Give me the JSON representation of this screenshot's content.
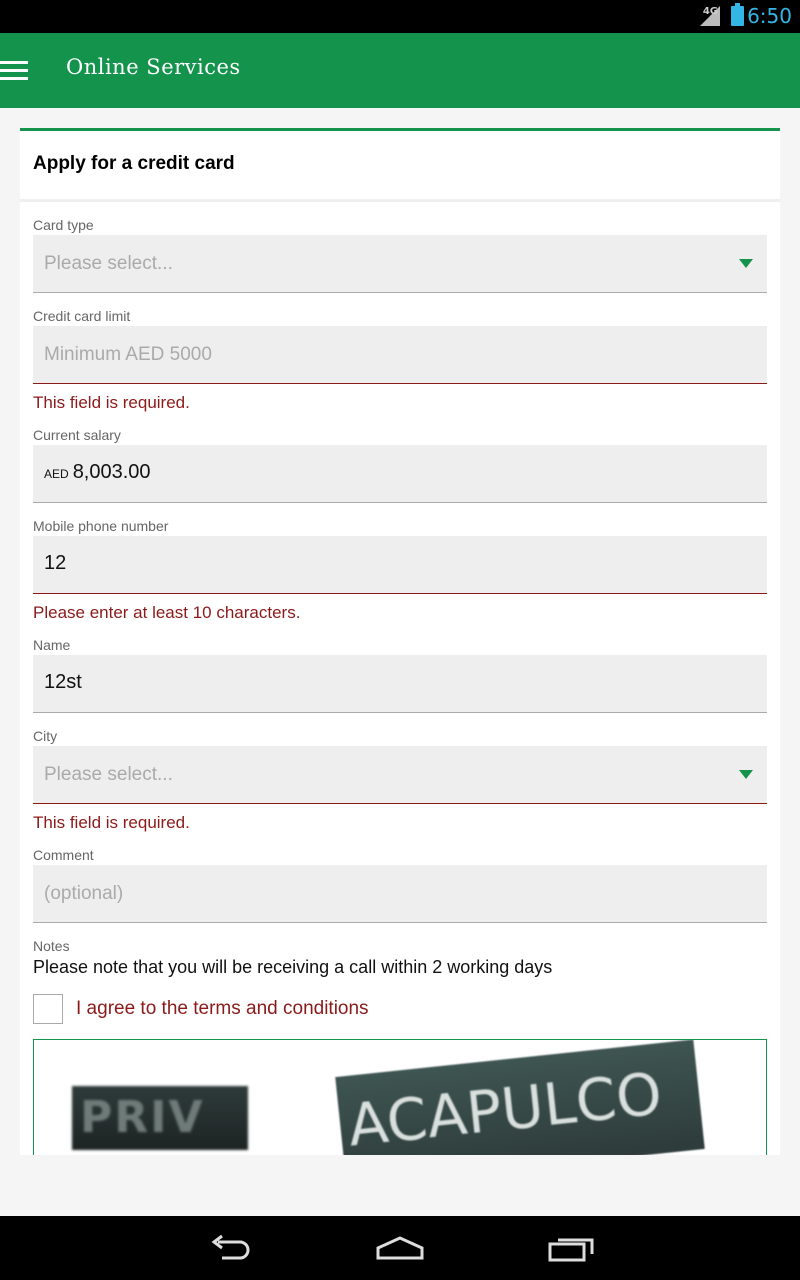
{
  "status_bar": {
    "network": "4G",
    "time": "6:50"
  },
  "app_bar": {
    "title": "Online Services",
    "menu_icon": "hamburger-menu-icon"
  },
  "form": {
    "title": "Apply for a credit card",
    "card_type": {
      "label": "Card type",
      "placeholder": "Please select..."
    },
    "credit_limit": {
      "label": "Credit card limit",
      "placeholder": "Minimum AED 5000",
      "error": "This field is required."
    },
    "current_salary": {
      "label": "Current salary",
      "currency": "AED",
      "value": "8,003.00"
    },
    "mobile_phone": {
      "label": "Mobile phone number",
      "value": "12",
      "error": "Please enter at least 10 characters."
    },
    "name": {
      "label": "Name",
      "value": "12st"
    },
    "city": {
      "label": "City",
      "placeholder": "Please select...",
      "error": "This field is required."
    },
    "comment": {
      "label": "Comment",
      "placeholder": "(optional)"
    },
    "notes": {
      "label": "Notes",
      "text": "Please note that you will be receiving a call within 2 working days"
    },
    "terms": {
      "label": "I agree to the terms and conditions"
    },
    "captcha": {
      "word1": "PRIV",
      "word2": "ACAPULCO"
    }
  },
  "colors": {
    "brand_green": "#13934c",
    "error_red": "#8b1a1a",
    "status_blue": "#33b5e5"
  },
  "navigation": {
    "back_icon": "back-icon",
    "home_icon": "home-icon",
    "recents_icon": "recent-apps-icon"
  }
}
